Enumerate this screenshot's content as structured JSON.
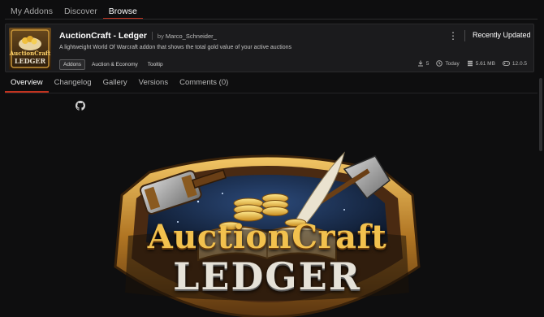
{
  "top_nav": {
    "tabs": [
      {
        "label": "My Addons"
      },
      {
        "label": "Discover"
      },
      {
        "label": "Browse"
      }
    ],
    "active_tab": "Browse"
  },
  "addon": {
    "title": "AuctionCraft - Ledger",
    "author_prefix": "by",
    "author": "Marco_Schneider_",
    "description": "A lightweight World Of Warcraft addon that shows the total gold value of your active auctions",
    "tags": [
      {
        "label": "Addons"
      },
      {
        "label": "Auction & Economy"
      },
      {
        "label": "Tooltip"
      }
    ],
    "status": "Recently Updated",
    "stats": {
      "downloads": "5",
      "updated": "Today",
      "size": "5.61 MB",
      "game_version": "12.0.5"
    },
    "thumbnail_text": {
      "line1": "AuctionCraft",
      "line2": "LEDGER"
    }
  },
  "sub_nav": {
    "tabs": [
      {
        "label": "Overview"
      },
      {
        "label": "Changelog"
      },
      {
        "label": "Gallery"
      },
      {
        "label": "Versions"
      },
      {
        "label": "Comments (0)"
      }
    ],
    "active_tab": "Overview"
  },
  "banner": {
    "line1": "AuctionCraft",
    "line2": "LEDGER"
  },
  "colors": {
    "background": "#0e0e0f",
    "card": "#1b1b1d",
    "accent": "#c2331f",
    "gold": "#e2b24a"
  }
}
